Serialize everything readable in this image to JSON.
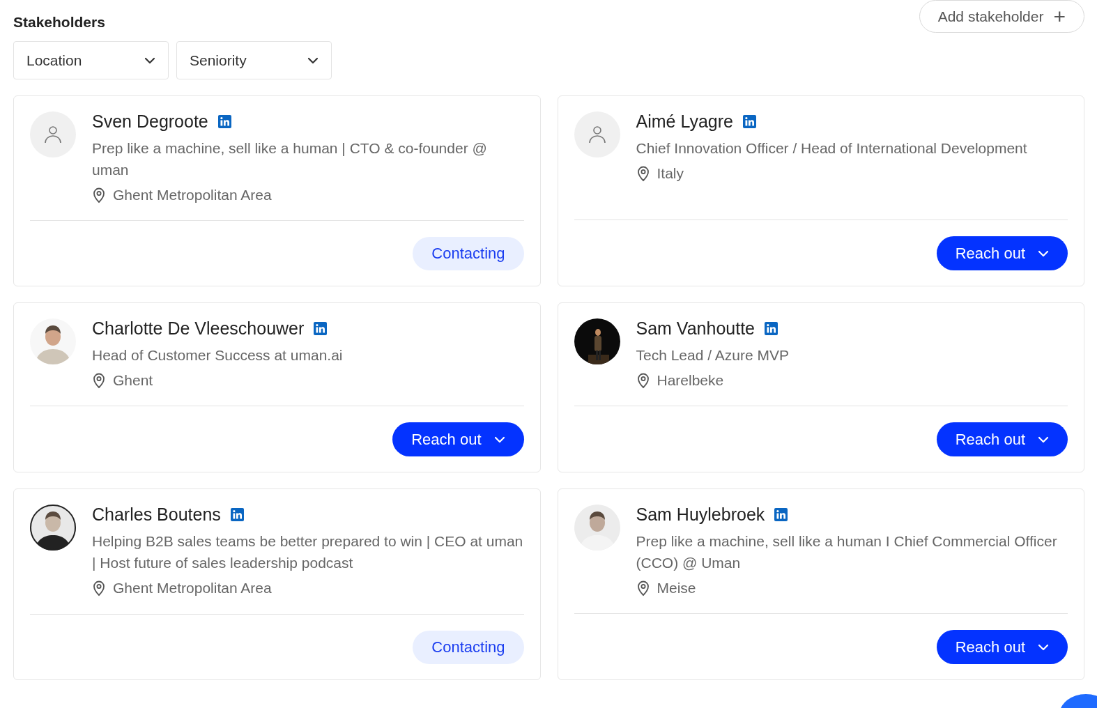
{
  "title": "Stakeholders",
  "add_button": {
    "label": "Add stakeholder",
    "icon": "+"
  },
  "filters": [
    {
      "label": "Location"
    },
    {
      "label": "Seniority"
    }
  ],
  "stakeholders": [
    {
      "name": "Sven Degroote",
      "headline": "Prep like a machine, sell like a human | CTO & co-founder @ uman",
      "location": "Ghent Metropolitan Area",
      "avatar": {
        "kind": "placeholder"
      },
      "action": {
        "kind": "status",
        "label": "Contacting"
      }
    },
    {
      "name": "Aimé Lyagre",
      "headline": "Chief Innovation Officer / Head of International Development",
      "location": "Italy",
      "avatar": {
        "kind": "placeholder"
      },
      "action": {
        "kind": "menu",
        "label": "Reach out"
      }
    },
    {
      "name": "Charlotte De Vleeschouwer",
      "headline": "Head of Customer Success at uman.ai",
      "location": "Ghent",
      "action": {
        "kind": "menu",
        "label": "Reach out"
      }
    },
    {
      "name": "Sam Vanhoutte",
      "headline": "Tech Lead / Azure MVP",
      "location": "Harelbeke",
      "action": {
        "kind": "menu",
        "label": "Reach out"
      }
    },
    {
      "name": "Charles Boutens",
      "headline": "Helping B2B sales teams be better prepared to win | CEO at uman | Host future of sales leadership podcast",
      "location": "Ghent Metropolitan Area",
      "action": {
        "kind": "status",
        "label": "Contacting"
      }
    },
    {
      "name": "Sam Huylebroek",
      "headline": "Prep like a machine, sell like a human I Chief Commercial Officer (CCO) @ Uman",
      "location": "Meise",
      "action": {
        "kind": "menu",
        "label": "Reach out"
      }
    }
  ]
}
